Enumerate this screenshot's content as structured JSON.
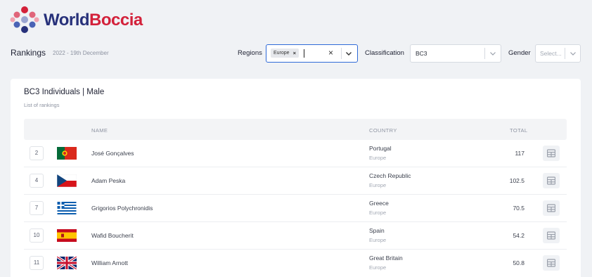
{
  "logo": {
    "word1": "World",
    "word2": "Boccia"
  },
  "header": {
    "title": "Rankings",
    "date": "2022 - 19th December"
  },
  "filters": {
    "regions": {
      "label": "Regions",
      "chip": "Europe",
      "chip_remove": "×",
      "clear": "×"
    },
    "classification": {
      "label": "Classification",
      "value": "BC3"
    },
    "gender": {
      "label": "Gender",
      "placeholder": "Select..."
    }
  },
  "card": {
    "title": "BC3 Individuals | Male",
    "subtitle": "List of rankings",
    "columns": {
      "name": "NAME",
      "country": "COUNTRY",
      "total": "TOTAL"
    },
    "rows": [
      {
        "rank": "2",
        "flag": "portugal-flag",
        "name": "José Gonçalves",
        "country": "Portugal",
        "region": "Europe",
        "total": "117"
      },
      {
        "rank": "4",
        "flag": "czech-flag",
        "name": "Adam Peska",
        "country": "Czech Republic",
        "region": "Europe",
        "total": "102.5"
      },
      {
        "rank": "7",
        "flag": "greece-flag",
        "name": "Grigorios Polychronidis",
        "country": "Greece",
        "region": "Europe",
        "total": "70.5"
      },
      {
        "rank": "10",
        "flag": "spain-flag",
        "name": "Wafid Boucherit",
        "country": "Spain",
        "region": "Europe",
        "total": "54.2"
      },
      {
        "rank": "11",
        "flag": "uk-flag",
        "name": "William Arnott",
        "country": "Great Britain",
        "region": "Europe",
        "total": "50.8"
      }
    ]
  },
  "colors": {
    "accent": "#2f6ad8",
    "brand_blue": "#27317a",
    "brand_red": "#d3213a"
  }
}
